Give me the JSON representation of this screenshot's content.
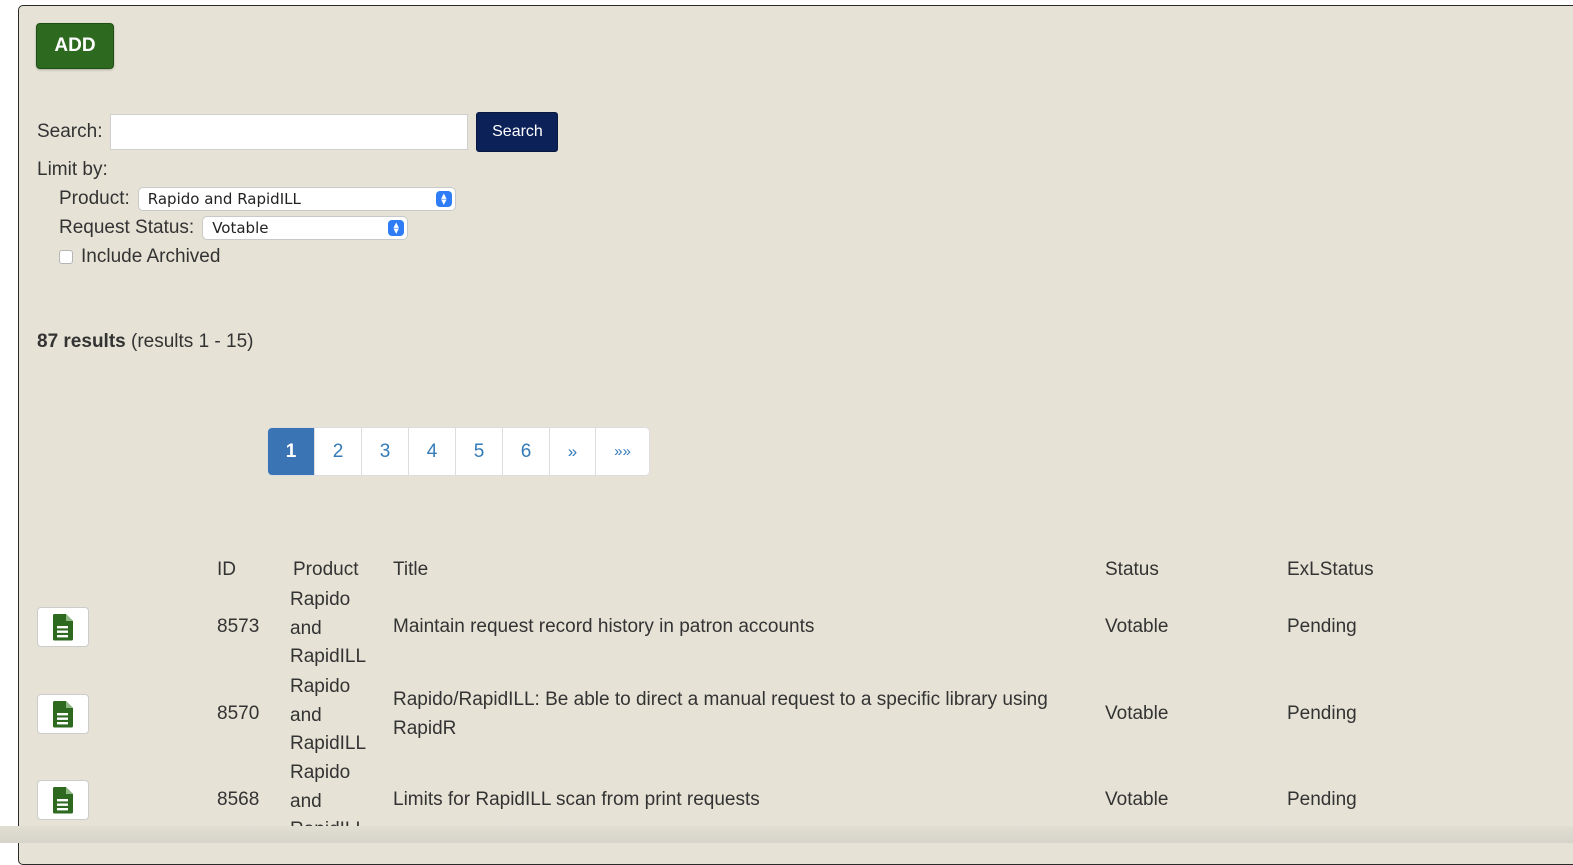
{
  "toolbar": {
    "add_label": "ADD"
  },
  "search": {
    "label": "Search:",
    "value": "",
    "placeholder": "",
    "button_label": "Search"
  },
  "limit": {
    "label": "Limit by:",
    "product": {
      "label": "Product:",
      "selected": "Rapido and RapidILL"
    },
    "status": {
      "label": "Request Status:",
      "selected": "Votable"
    },
    "archived": {
      "label": "Include Archived",
      "checked": false
    }
  },
  "results": {
    "count": "87 results",
    "range": "(results 1 - 15)"
  },
  "pagination": {
    "pages": [
      "1",
      "2",
      "3",
      "4",
      "5",
      "6"
    ],
    "active": "1",
    "next": "»",
    "last": "»»"
  },
  "table": {
    "headers": {
      "id": "ID",
      "product": "Product",
      "title": "Title",
      "status": "Status",
      "exl_status": "ExLStatus"
    },
    "rows": [
      {
        "id": "8573",
        "product": [
          "Rapido",
          "and",
          "RapidILL"
        ],
        "title": "Maintain request record history in patron accounts",
        "status": "Votable",
        "exl_status": "Pending",
        "icon": "document-icon"
      },
      {
        "id": "8570",
        "product": [
          "Rapido",
          "and",
          "RapidILL"
        ],
        "title": "Rapido/RapidILL: Be able to direct a manual request to a specific library using RapidR",
        "status": "Votable",
        "exl_status": "Pending",
        "icon": "document-icon"
      },
      {
        "id": "8568",
        "product": [
          "Rapido",
          "and",
          "RapidILL"
        ],
        "title": "Limits for RapidILL scan from print requests",
        "status": "Votable",
        "exl_status": "Pending",
        "icon": "document-icon"
      }
    ]
  },
  "colors": {
    "panel_bg": "#e6e3d6",
    "add_button": "#2d6a1f",
    "search_button": "#0c2157",
    "page_active": "#3a74b5",
    "link": "#337ab7",
    "doc_icon": "#2d6a1f"
  }
}
